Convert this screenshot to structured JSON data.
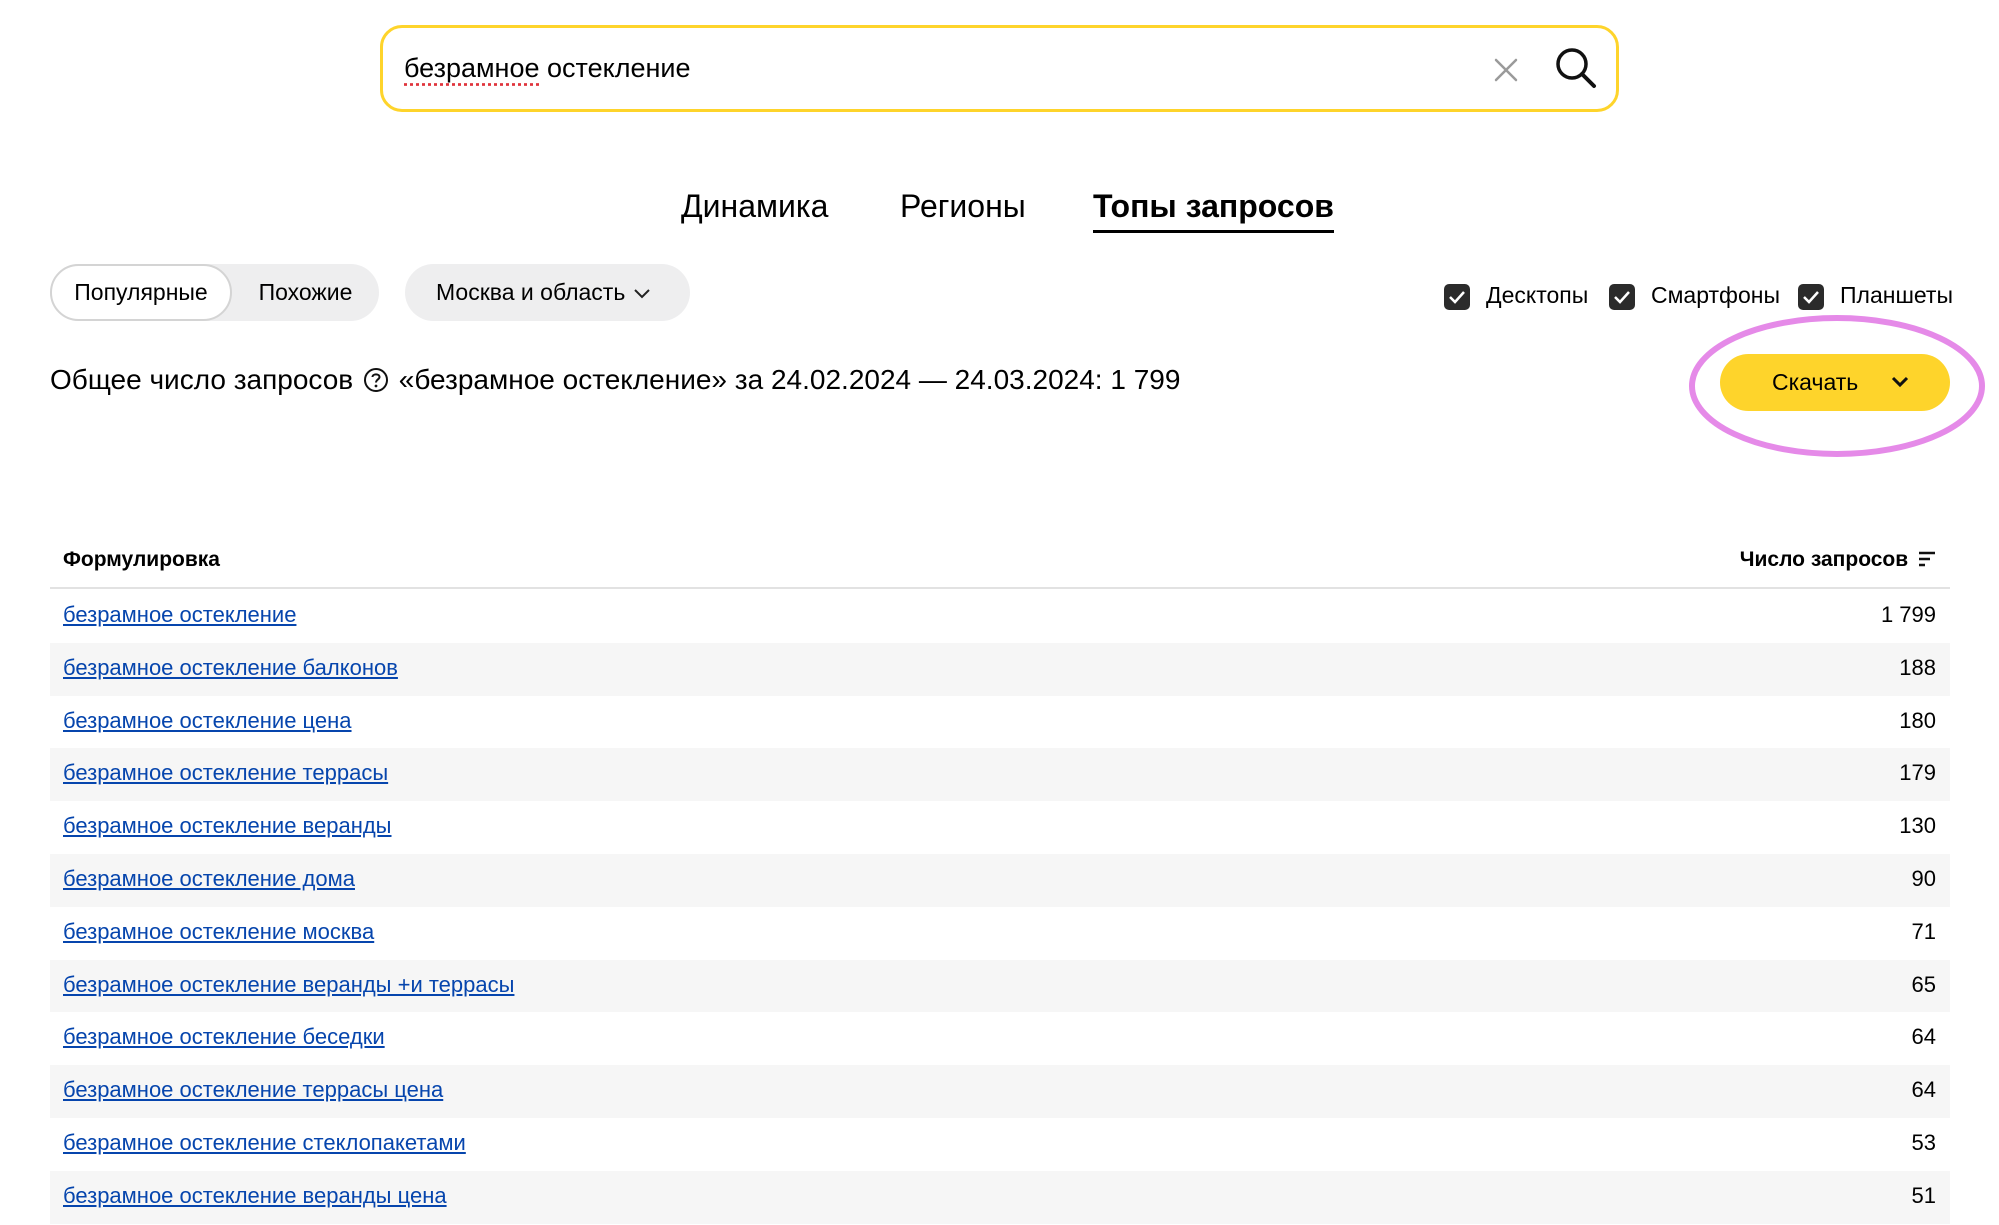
{
  "search": {
    "query_misspelled_word": "безрамное",
    "query_rest": " остекление",
    "clear_icon": "close-icon",
    "submit_icon": "search-icon"
  },
  "tabs": [
    {
      "label": "Динамика",
      "active": false
    },
    {
      "label": "Регионы",
      "active": false
    },
    {
      "label": "Топы запросов",
      "active": true
    }
  ],
  "filters": {
    "segments": [
      {
        "label": "Популярные",
        "active": true
      },
      {
        "label": "Похожие",
        "active": false
      }
    ],
    "region": {
      "label": "Москва и область",
      "icon": "chevron-down-icon"
    },
    "devices": [
      {
        "label": "Десктопы",
        "checked": true
      },
      {
        "label": "Смартфоны",
        "checked": true
      },
      {
        "label": "Планшеты",
        "checked": true
      }
    ]
  },
  "summary": {
    "prefix": "Общее число запросов",
    "help_icon": "help-icon",
    "suffix": "«безрамное остекление» за 24.02.2024 — 24.03.2024: 1 799"
  },
  "download": {
    "label": "Скачать",
    "icon": "chevron-down-icon"
  },
  "table": {
    "headers": {
      "phrase": "Формулировка",
      "count": "Число запросов",
      "sort_icon": "sort-icon"
    },
    "rows": [
      {
        "phrase": "безрамное остекление",
        "count": "1 799"
      },
      {
        "phrase": "безрамное остекление балконов",
        "count": "188"
      },
      {
        "phrase": "безрамное остекление цена",
        "count": "180"
      },
      {
        "phrase": "безрамное остекление террасы",
        "count": "179"
      },
      {
        "phrase": "безрамное остекление веранды",
        "count": "130"
      },
      {
        "phrase": "безрамное остекление дома",
        "count": "90"
      },
      {
        "phrase": "безрамное остекление москва",
        "count": "71"
      },
      {
        "phrase": "безрамное остекление веранды +и террасы",
        "count": "65"
      },
      {
        "phrase": "безрамное остекление беседки",
        "count": "64"
      },
      {
        "phrase": "безрамное остекление террасы цена",
        "count": "64"
      },
      {
        "phrase": "безрамное остекление стеклопакетами",
        "count": "53"
      },
      {
        "phrase": "безрамное остекление веранды цена",
        "count": "51"
      }
    ]
  },
  "colors": {
    "accent": "#fed42b",
    "link": "#0645ad",
    "annotation": "#e58ae8"
  }
}
